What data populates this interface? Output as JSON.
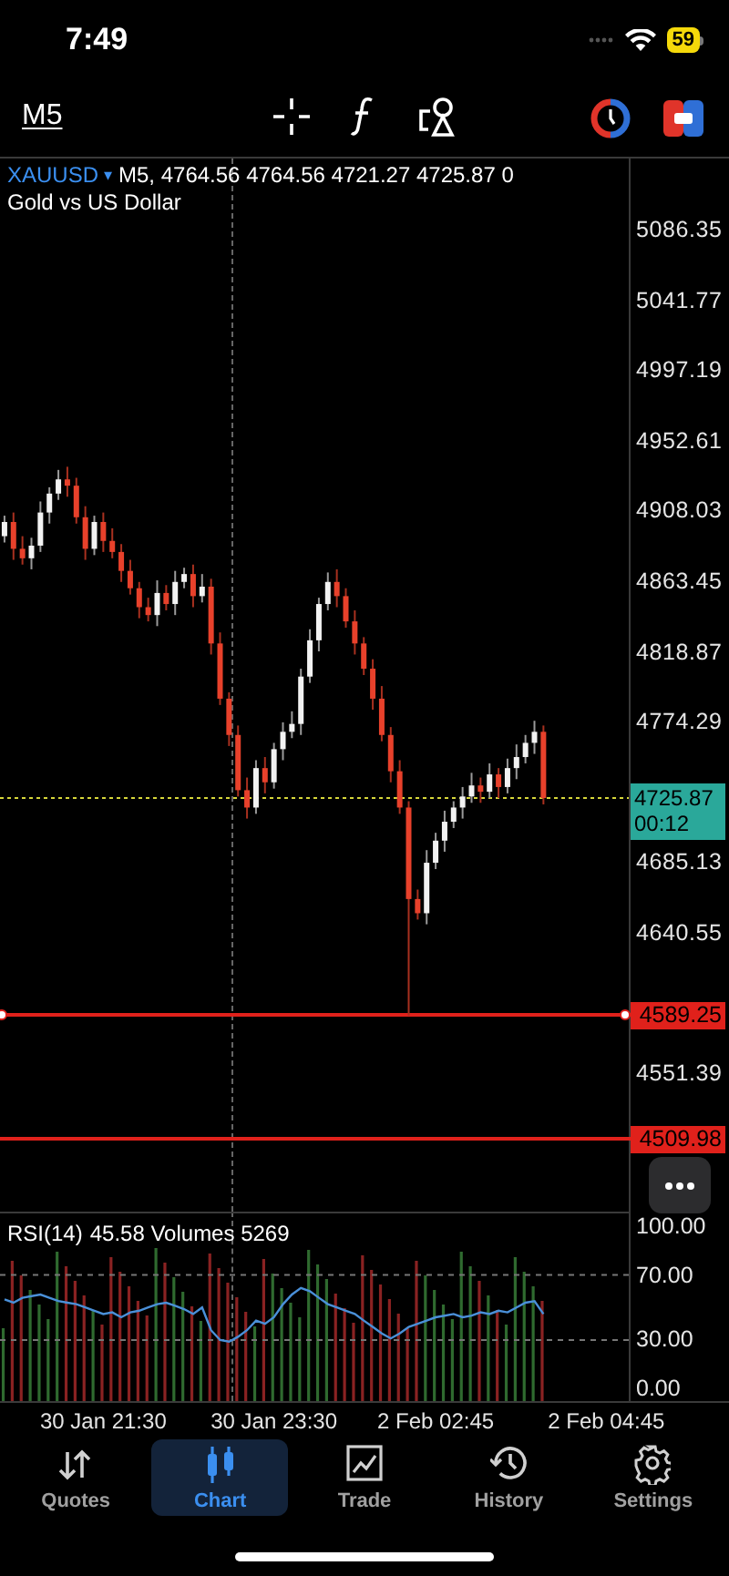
{
  "status_bar": {
    "time": "7:49",
    "battery": "59"
  },
  "toolbar": {
    "timeframe": "M5"
  },
  "chart_header": {
    "symbol": "XAUUSD",
    "dropdown": "▾",
    "ohlc": "M5, 4764.56 4764.56 4721.27 4725.87 0",
    "description": "Gold vs US Dollar"
  },
  "main_chart": {
    "chart_data": {
      "type": "candlestick",
      "ylim": [
        4462.72,
        5131.39
      ],
      "categories": [
        null,
        null,
        null,
        null,
        null,
        null,
        null,
        null,
        null,
        null,
        null,
        "30 Jan 21:30",
        null,
        null,
        null,
        null,
        null,
        null,
        null,
        null,
        null,
        null,
        null,
        null,
        null,
        null,
        null,
        null,
        null,
        null,
        "30 Jan 23:30",
        null,
        null,
        null,
        null,
        null,
        null,
        null,
        null,
        null,
        null,
        null,
        null,
        null,
        null,
        null,
        null,
        null,
        "2 Feb 02:45",
        null,
        null,
        null,
        null,
        null,
        null,
        null,
        null,
        null,
        null,
        null,
        null,
        null,
        null,
        null,
        null,
        null,
        null,
        "2 Feb 04:45",
        null,
        null
      ],
      "yticks": [
        {
          "value": 5086.35,
          "label": "5086.35"
        },
        {
          "value": 5041.77,
          "label": "5041.77"
        },
        {
          "value": 4997.19,
          "label": "4997.19"
        },
        {
          "value": 4952.61,
          "label": "4952.61"
        },
        {
          "value": 4908.03,
          "label": "4908.03"
        },
        {
          "value": 4863.45,
          "label": "4863.45"
        },
        {
          "value": 4818.87,
          "label": "4818.87"
        },
        {
          "value": 4774.29,
          "label": "4774.29"
        },
        {
          "value": 4685.13,
          "label": "4685.13"
        },
        {
          "value": 4640.55,
          "label": "4640.55"
        },
        {
          "value": 4551.39,
          "label": "4551.39"
        }
      ],
      "ohlc": [
        [
          4892,
          4905,
          4888,
          4901
        ],
        [
          4901,
          4907,
          4877,
          4884
        ],
        [
          4884,
          4892,
          4874,
          4878
        ],
        [
          4878,
          4891,
          4871,
          4886
        ],
        [
          4886,
          4914,
          4882,
          4907
        ],
        [
          4907,
          4923,
          4900,
          4919
        ],
        [
          4919,
          4934,
          4915,
          4928
        ],
        [
          4928,
          4936,
          4917,
          4924
        ],
        [
          4924,
          4929,
          4900,
          4904
        ],
        [
          4904,
          4911,
          4877,
          4884
        ],
        [
          4884,
          4905,
          4880,
          4901
        ],
        [
          4901,
          4907,
          4882,
          4889
        ],
        [
          4889,
          4897,
          4878,
          4882
        ],
        [
          4882,
          4887,
          4863,
          4870
        ],
        [
          4870,
          4877,
          4855,
          4859
        ],
        [
          4859,
          4863,
          4840,
          4847
        ],
        [
          4847,
          4853,
          4838,
          4842
        ],
        [
          4842,
          4864,
          4835,
          4856
        ],
        [
          4856,
          4861,
          4845,
          4849
        ],
        [
          4849,
          4870,
          4842,
          4863
        ],
        [
          4863,
          4872,
          4859,
          4868
        ],
        [
          4868,
          4874,
          4847,
          4854
        ],
        [
          4854,
          4868,
          4850,
          4860
        ],
        [
          4860,
          4865,
          4817,
          4824
        ],
        [
          4824,
          4831,
          4785,
          4789
        ],
        [
          4789,
          4793,
          4759,
          4766
        ],
        [
          4766,
          4772,
          4727,
          4731
        ],
        [
          4731,
          4739,
          4713,
          4720
        ],
        [
          4720,
          4750,
          4716,
          4745
        ],
        [
          4745,
          4752,
          4729,
          4736
        ],
        [
          4736,
          4761,
          4732,
          4757
        ],
        [
          4757,
          4774,
          4750,
          4768
        ],
        [
          4768,
          4781,
          4764,
          4773
        ],
        [
          4773,
          4808,
          4766,
          4803
        ],
        [
          4803,
          4833,
          4799,
          4826
        ],
        [
          4826,
          4853,
          4819,
          4849
        ],
        [
          4849,
          4869,
          4845,
          4863
        ],
        [
          4863,
          4871,
          4847,
          4854
        ],
        [
          4854,
          4859,
          4834,
          4838
        ],
        [
          4838,
          4845,
          4817,
          4824
        ],
        [
          4824,
          4828,
          4804,
          4808
        ],
        [
          4808,
          4814,
          4782,
          4789
        ],
        [
          4789,
          4797,
          4762,
          4766
        ],
        [
          4766,
          4771,
          4736,
          4743
        ],
        [
          4743,
          4750,
          4716,
          4720
        ],
        [
          4720,
          4724,
          4588,
          4662
        ],
        [
          4662,
          4668,
          4649,
          4653
        ],
        [
          4653,
          4693,
          4646,
          4685
        ],
        [
          4685,
          4704,
          4681,
          4699
        ],
        [
          4699,
          4718,
          4692,
          4711
        ],
        [
          4711,
          4724,
          4707,
          4720
        ],
        [
          4720,
          4733,
          4713,
          4727
        ],
        [
          4727,
          4742,
          4723,
          4734
        ],
        [
          4734,
          4739,
          4723,
          4730
        ],
        [
          4730,
          4748,
          4726,
          4741
        ],
        [
          4741,
          4745,
          4726,
          4733
        ],
        [
          4733,
          4751,
          4729,
          4745
        ],
        [
          4745,
          4760,
          4738,
          4752
        ],
        [
          4752,
          4766,
          4748,
          4761
        ],
        [
          4761,
          4775,
          4754,
          4768
        ],
        [
          4768,
          4772,
          4722,
          4726
        ],
        null,
        null,
        null,
        null,
        null,
        null,
        null,
        null,
        null
      ]
    }
  },
  "price_axis": {
    "current_price": {
      "price": "4725.87",
      "countdown": "00:12"
    },
    "levels": [
      {
        "price": "4589.25",
        "selected": true
      },
      {
        "price": "4509.98",
        "selected": false
      }
    ]
  },
  "indicator": {
    "value_label": "45.58 Volumes 5269",
    "chart_data": {
      "type": "line",
      "ylim": [
        -7.58,
        109
      ],
      "grid": true,
      "yticks": [
        {
          "value": 100,
          "label": "100.00"
        },
        {
          "value": 70,
          "label": "70.00"
        },
        {
          "value": 30,
          "label": "30.00"
        },
        {
          "value": 0,
          "label": "0.00"
        }
      ],
      "series": [
        {
          "name": "RSI(14)",
          "color": "#4a90d9",
          "values": [
            55,
            53,
            56,
            57,
            58,
            56,
            54,
            53,
            52,
            50,
            48,
            46,
            47,
            44,
            47,
            48,
            50,
            52,
            53,
            51,
            49,
            46,
            50,
            36,
            30,
            29,
            32,
            36,
            42,
            40,
            44,
            52,
            58,
            62,
            60,
            56,
            52,
            50,
            48,
            46,
            42,
            38,
            34,
            31,
            34,
            38,
            40,
            42,
            44,
            45,
            46,
            44,
            45,
            47,
            46,
            48,
            47,
            50,
            53,
            54,
            46
          ]
        }
      ]
    }
  },
  "tab_bar": [
    {
      "label": "Quotes",
      "kind": "quotes",
      "selected": false
    },
    {
      "label": "Chart",
      "kind": "chart",
      "selected": true
    },
    {
      "label": "Trade",
      "kind": "trade",
      "selected": false
    },
    {
      "label": "History",
      "kind": "history",
      "selected": false
    },
    {
      "label": "Settings",
      "kind": "settings",
      "selected": false
    }
  ]
}
